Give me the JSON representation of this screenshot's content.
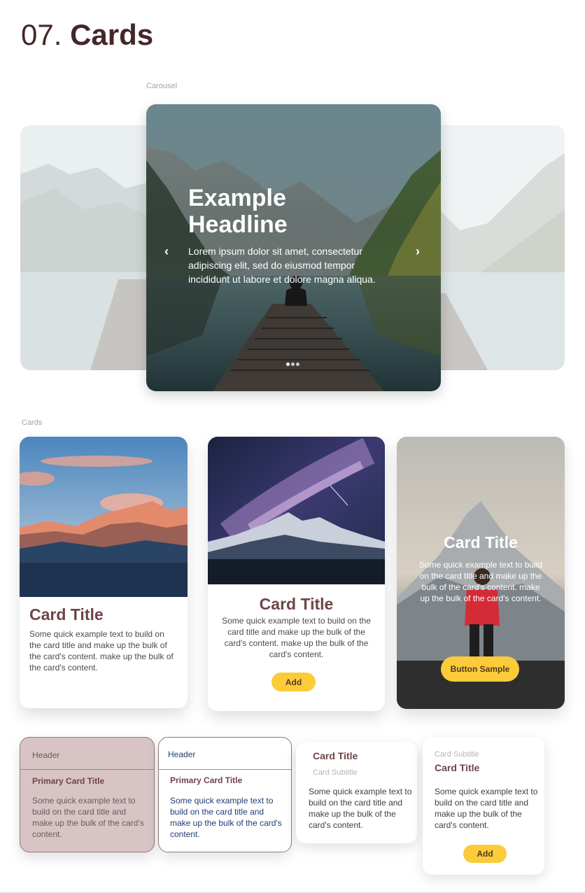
{
  "page": {
    "number": "07.",
    "title": "Cards"
  },
  "carousel": {
    "section_label": "Carousel",
    "slide": {
      "headline": "Example Headline",
      "text": "Lorem ipsum dolor sit amet, consectetur adipiscing elit, sed do eiusmod tempor incididunt ut labore et dolore magna aliqua."
    },
    "prev_icon": "chevron-left-icon",
    "next_icon": "chevron-right-icon",
    "dot_count": 3,
    "active_dot": 1
  },
  "cards": {
    "section_label": "Cards",
    "card_a": {
      "title": "Card Title",
      "text": "Some quick example text to build on the card title and make up the bulk of the card's content.  make up the bulk of the card's content."
    },
    "card_b": {
      "title": "Card Title",
      "text": "Some quick example text to build on the card title and make up the bulk of the card's content.  make up the bulk of the card's content.",
      "button": "Add"
    },
    "card_c": {
      "title": "Card Title",
      "text": "Some quick example text to build on the card title and make up the bulk of the card's content.  make up the bulk of the card's content.",
      "button": "Button Sample"
    }
  },
  "small_cards": {
    "sc1": {
      "header": "Header",
      "title": "Primary Card Title",
      "text": "Some quick example text to build on the card title and make up the bulk of the card's content."
    },
    "sc2": {
      "header": "Header",
      "title": "Primary Card Title",
      "text": "Some quick example text to build on the card title and make up the bulk of the card's content."
    },
    "sc3": {
      "title": "Card Title",
      "subtitle": "Card Subtitle",
      "text": "Some quick example text to build on the card title and make up the bulk of the card's content."
    },
    "sc4": {
      "subtitle": "Card Subtitle",
      "title": "Card Title",
      "text": "Some quick example text to build on the card title and make up the bulk of the card's content.",
      "button": "Add"
    }
  },
  "colors": {
    "accent": "#fccb3a",
    "title": "#6e4548",
    "heading": "#44272a",
    "muted_card": "#d8c4c5",
    "blue_text": "#1f3c78"
  }
}
